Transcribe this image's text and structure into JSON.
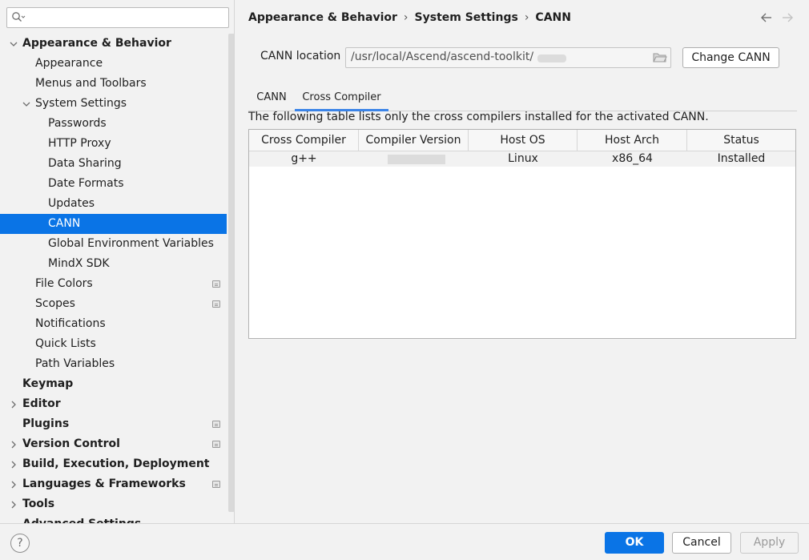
{
  "search": {
    "placeholder": "",
    "icon": "search-icon"
  },
  "tree": [
    {
      "label": "Appearance & Behavior",
      "level": 0,
      "bold": true,
      "arrow": "down"
    },
    {
      "label": "Appearance",
      "level": 1
    },
    {
      "label": "Menus and Toolbars",
      "level": 1
    },
    {
      "label": "System Settings",
      "level": 1,
      "arrow": "down"
    },
    {
      "label": "Passwords",
      "level": 2
    },
    {
      "label": "HTTP Proxy",
      "level": 2
    },
    {
      "label": "Data Sharing",
      "level": 2
    },
    {
      "label": "Date Formats",
      "level": 2
    },
    {
      "label": "Updates",
      "level": 2
    },
    {
      "label": "CANN",
      "level": 2,
      "selected": true
    },
    {
      "label": "Global Environment Variables",
      "level": 2
    },
    {
      "label": "MindX SDK",
      "level": 2
    },
    {
      "label": "File Colors",
      "level": 1,
      "project": true
    },
    {
      "label": "Scopes",
      "level": 1,
      "project": true
    },
    {
      "label": "Notifications",
      "level": 1
    },
    {
      "label": "Quick Lists",
      "level": 1
    },
    {
      "label": "Path Variables",
      "level": 1
    },
    {
      "label": "Keymap",
      "level": 0,
      "bold": true
    },
    {
      "label": "Editor",
      "level": 0,
      "bold": true,
      "arrow": "right"
    },
    {
      "label": "Plugins",
      "level": 0,
      "bold": true,
      "project": true
    },
    {
      "label": "Version Control",
      "level": 0,
      "bold": true,
      "arrow": "right",
      "project": true
    },
    {
      "label": "Build, Execution, Deployment",
      "level": 0,
      "bold": true,
      "arrow": "right"
    },
    {
      "label": "Languages & Frameworks",
      "level": 0,
      "bold": true,
      "arrow": "right",
      "project": true
    },
    {
      "label": "Tools",
      "level": 0,
      "bold": true,
      "arrow": "right"
    },
    {
      "label": "Advanced Settings",
      "level": 0,
      "bold": true
    }
  ],
  "breadcrumb": {
    "part1": "Appearance & Behavior",
    "sep": "›",
    "part2": "System Settings",
    "part3": "CANN"
  },
  "cann_location": {
    "label": "CANN location",
    "value": "/usr/local/Ascend/ascend-toolkit/",
    "change_button": "Change CANN"
  },
  "tabs": [
    {
      "label": "CANN",
      "active": false
    },
    {
      "label": "Cross Compiler",
      "active": true
    }
  ],
  "description": "The following table lists only the cross compilers installed for the activated CANN.",
  "table": {
    "columns": [
      "Cross Compiler",
      "Compiler Version",
      "Host OS",
      "Host Arch",
      "Status"
    ],
    "rows": [
      [
        "g++",
        "",
        "Linux",
        "x86_64",
        "Installed"
      ]
    ]
  },
  "footer": {
    "help": "?",
    "ok": "OK",
    "cancel": "Cancel",
    "apply": "Apply"
  },
  "colors": {
    "accent": "#0a74e6",
    "tab_underline": "#3b84e8"
  }
}
